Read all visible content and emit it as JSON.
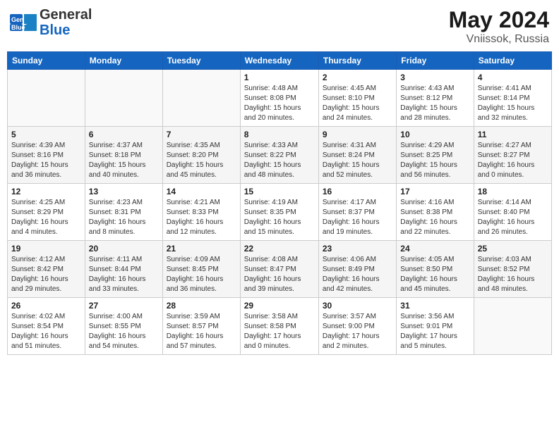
{
  "header": {
    "logo_general": "General",
    "logo_blue": "Blue",
    "month_year": "May 2024",
    "location": "Vniissok, Russia"
  },
  "weekdays": [
    "Sunday",
    "Monday",
    "Tuesday",
    "Wednesday",
    "Thursday",
    "Friday",
    "Saturday"
  ],
  "weeks": [
    [
      {
        "day": "",
        "info": ""
      },
      {
        "day": "",
        "info": ""
      },
      {
        "day": "",
        "info": ""
      },
      {
        "day": "1",
        "info": "Sunrise: 4:48 AM\nSunset: 8:08 PM\nDaylight: 15 hours\nand 20 minutes."
      },
      {
        "day": "2",
        "info": "Sunrise: 4:45 AM\nSunset: 8:10 PM\nDaylight: 15 hours\nand 24 minutes."
      },
      {
        "day": "3",
        "info": "Sunrise: 4:43 AM\nSunset: 8:12 PM\nDaylight: 15 hours\nand 28 minutes."
      },
      {
        "day": "4",
        "info": "Sunrise: 4:41 AM\nSunset: 8:14 PM\nDaylight: 15 hours\nand 32 minutes."
      }
    ],
    [
      {
        "day": "5",
        "info": "Sunrise: 4:39 AM\nSunset: 8:16 PM\nDaylight: 15 hours\nand 36 minutes."
      },
      {
        "day": "6",
        "info": "Sunrise: 4:37 AM\nSunset: 8:18 PM\nDaylight: 15 hours\nand 40 minutes."
      },
      {
        "day": "7",
        "info": "Sunrise: 4:35 AM\nSunset: 8:20 PM\nDaylight: 15 hours\nand 45 minutes."
      },
      {
        "day": "8",
        "info": "Sunrise: 4:33 AM\nSunset: 8:22 PM\nDaylight: 15 hours\nand 48 minutes."
      },
      {
        "day": "9",
        "info": "Sunrise: 4:31 AM\nSunset: 8:24 PM\nDaylight: 15 hours\nand 52 minutes."
      },
      {
        "day": "10",
        "info": "Sunrise: 4:29 AM\nSunset: 8:25 PM\nDaylight: 15 hours\nand 56 minutes."
      },
      {
        "day": "11",
        "info": "Sunrise: 4:27 AM\nSunset: 8:27 PM\nDaylight: 16 hours\nand 0 minutes."
      }
    ],
    [
      {
        "day": "12",
        "info": "Sunrise: 4:25 AM\nSunset: 8:29 PM\nDaylight: 16 hours\nand 4 minutes."
      },
      {
        "day": "13",
        "info": "Sunrise: 4:23 AM\nSunset: 8:31 PM\nDaylight: 16 hours\nand 8 minutes."
      },
      {
        "day": "14",
        "info": "Sunrise: 4:21 AM\nSunset: 8:33 PM\nDaylight: 16 hours\nand 12 minutes."
      },
      {
        "day": "15",
        "info": "Sunrise: 4:19 AM\nSunset: 8:35 PM\nDaylight: 16 hours\nand 15 minutes."
      },
      {
        "day": "16",
        "info": "Sunrise: 4:17 AM\nSunset: 8:37 PM\nDaylight: 16 hours\nand 19 minutes."
      },
      {
        "day": "17",
        "info": "Sunrise: 4:16 AM\nSunset: 8:38 PM\nDaylight: 16 hours\nand 22 minutes."
      },
      {
        "day": "18",
        "info": "Sunrise: 4:14 AM\nSunset: 8:40 PM\nDaylight: 16 hours\nand 26 minutes."
      }
    ],
    [
      {
        "day": "19",
        "info": "Sunrise: 4:12 AM\nSunset: 8:42 PM\nDaylight: 16 hours\nand 29 minutes."
      },
      {
        "day": "20",
        "info": "Sunrise: 4:11 AM\nSunset: 8:44 PM\nDaylight: 16 hours\nand 33 minutes."
      },
      {
        "day": "21",
        "info": "Sunrise: 4:09 AM\nSunset: 8:45 PM\nDaylight: 16 hours\nand 36 minutes."
      },
      {
        "day": "22",
        "info": "Sunrise: 4:08 AM\nSunset: 8:47 PM\nDaylight: 16 hours\nand 39 minutes."
      },
      {
        "day": "23",
        "info": "Sunrise: 4:06 AM\nSunset: 8:49 PM\nDaylight: 16 hours\nand 42 minutes."
      },
      {
        "day": "24",
        "info": "Sunrise: 4:05 AM\nSunset: 8:50 PM\nDaylight: 16 hours\nand 45 minutes."
      },
      {
        "day": "25",
        "info": "Sunrise: 4:03 AM\nSunset: 8:52 PM\nDaylight: 16 hours\nand 48 minutes."
      }
    ],
    [
      {
        "day": "26",
        "info": "Sunrise: 4:02 AM\nSunset: 8:54 PM\nDaylight: 16 hours\nand 51 minutes."
      },
      {
        "day": "27",
        "info": "Sunrise: 4:00 AM\nSunset: 8:55 PM\nDaylight: 16 hours\nand 54 minutes."
      },
      {
        "day": "28",
        "info": "Sunrise: 3:59 AM\nSunset: 8:57 PM\nDaylight: 16 hours\nand 57 minutes."
      },
      {
        "day": "29",
        "info": "Sunrise: 3:58 AM\nSunset: 8:58 PM\nDaylight: 17 hours\nand 0 minutes."
      },
      {
        "day": "30",
        "info": "Sunrise: 3:57 AM\nSunset: 9:00 PM\nDaylight: 17 hours\nand 2 minutes."
      },
      {
        "day": "31",
        "info": "Sunrise: 3:56 AM\nSunset: 9:01 PM\nDaylight: 17 hours\nand 5 minutes."
      },
      {
        "day": "",
        "info": ""
      }
    ]
  ]
}
